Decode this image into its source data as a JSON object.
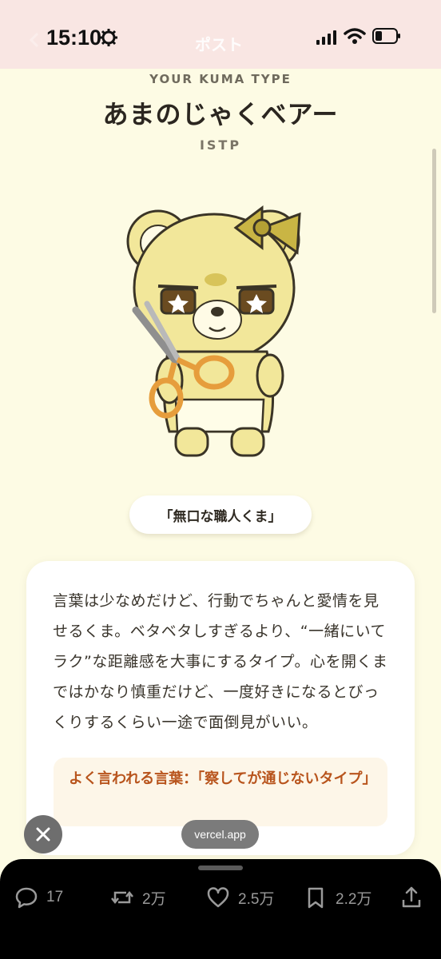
{
  "status_bar": {
    "time": "15:10"
  },
  "nav": {
    "title_faint": "ポスト"
  },
  "header": {
    "subtitle": "YOUR KUMA TYPE",
    "title": "あまのじゃくベアー",
    "mbti": "ISTP"
  },
  "nickname": "「無口な職人くま」",
  "description": "言葉は少なめだけど、行動でちゃんと愛情を見せるくま。ベタベタしすぎるより、“一緒にいてラク”な距離感を大事にするタイプ。心を開くまではかなり慎重だけど、一度好きになるとびっくりするくらい一途で面倒見がいい。",
  "quote": "よく言われる言葉：「察してが通じないタイプ」",
  "overlay": {
    "domain": "vercel.app"
  },
  "actions": {
    "replies": "17",
    "reposts": "2万",
    "likes": "2.5万",
    "bookmarks": "2.2万"
  },
  "colors": {
    "background": "#fdfbe4",
    "status_bar": "#f9e6e3",
    "accent_quote": "#b8541c",
    "bear": "#f2e79a"
  }
}
